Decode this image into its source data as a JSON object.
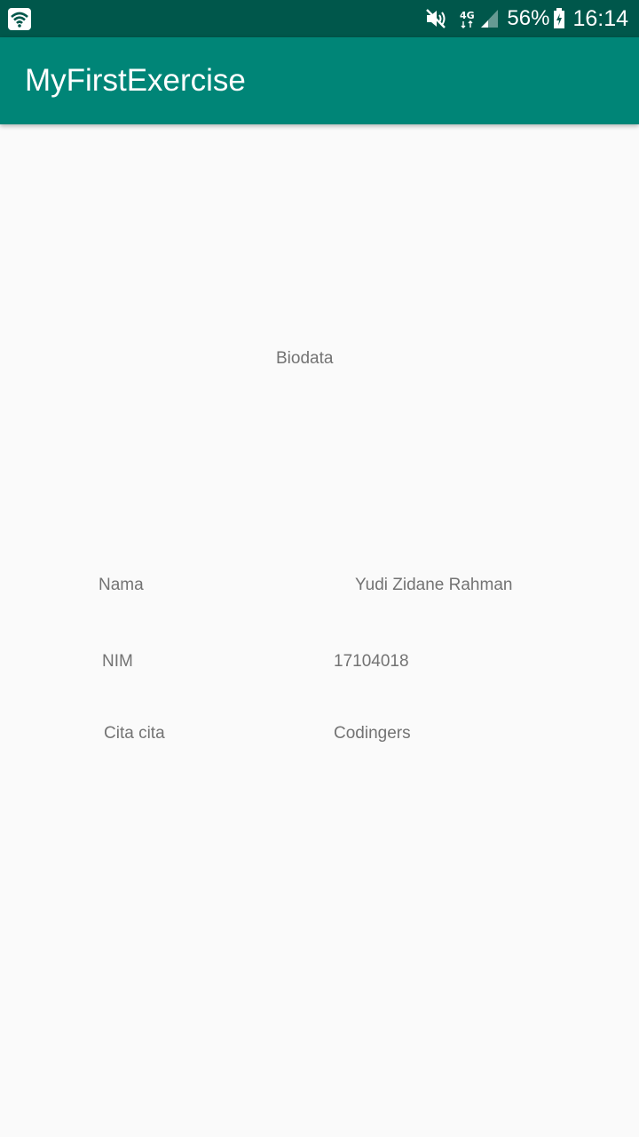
{
  "status_bar": {
    "left_icon": "wifi-app-icon",
    "icons": [
      "mute-icon",
      "4g-icon",
      "signal-icon",
      "battery-icon"
    ],
    "network": "4G",
    "battery": "56%",
    "time": "16:14"
  },
  "app_bar": {
    "title": "MyFirstExercise",
    "color": "#008577"
  },
  "content": {
    "heading": "Biodata",
    "rows": [
      {
        "label": "Nama",
        "value": "Yudi Zidane Rahman"
      },
      {
        "label": "NIM",
        "value": "17104018"
      },
      {
        "label": "Cita cita",
        "value": "Codingers"
      }
    ]
  }
}
